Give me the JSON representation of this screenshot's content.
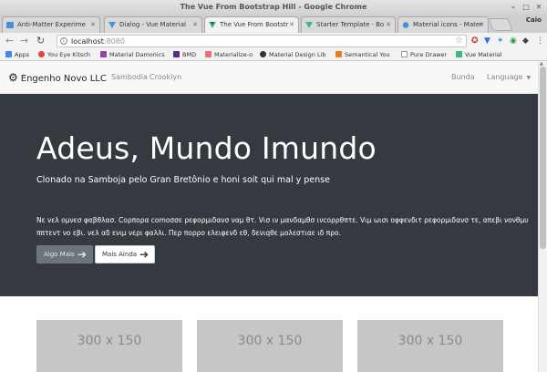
{
  "window": {
    "title": "The Vue From Bootstrap Hill - Google Chrome",
    "minimize": "–",
    "maximize": "□",
    "close": "✕",
    "profile": "Caio"
  },
  "tabs": [
    {
      "label": "Anti-Matter Experime",
      "active": false,
      "icon": "page-icon",
      "icon_color": "#4a90d9"
    },
    {
      "label": "Dialog - Vue Material",
      "active": false,
      "icon": "vue-icon",
      "icon_color": "#4a90d9"
    },
    {
      "label": "The Vue From Bootstr",
      "active": true,
      "icon": "vue-icon",
      "icon_color": "#41b883"
    },
    {
      "label": "Starter Template · Bo",
      "active": false,
      "icon": "vue-icon",
      "icon_color": "#41b883"
    },
    {
      "label": "Material icons - Mater",
      "active": false,
      "icon": "material-icon",
      "icon_color": "#4a90d9"
    }
  ],
  "toolbar": {
    "back": "←",
    "forward": "→",
    "reload": "↻",
    "url_host": "localhost",
    "url_port": ":8080",
    "star": "☆"
  },
  "bookmarks": [
    {
      "label": "Apps",
      "icon_color": "#4285f4"
    },
    {
      "label": "You Eye Kitsch",
      "icon_color": "#ea4335"
    },
    {
      "label": "Material Damonics",
      "icon_color": "#8e44ad"
    },
    {
      "label": "BMD",
      "icon_color": "#5b2c83"
    },
    {
      "label": "Materialize-o",
      "icon_color": "#ee6e73"
    },
    {
      "label": "Material Design Lib",
      "icon_color": "#333333"
    },
    {
      "label": "Semantical You",
      "icon_color": "#e67e22"
    },
    {
      "label": "Pure Drawer",
      "icon_color": "#999999"
    },
    {
      "label": "Vue Material",
      "icon_color": "#41b883"
    }
  ],
  "navbar": {
    "brand": "Engenho Novo LLC",
    "links": [
      "Sambodia",
      "Crooklyn"
    ],
    "right_link": "Bunda",
    "dropdown": "Language"
  },
  "jumbotron": {
    "heading": "Adeus, Mundo Imundo",
    "lead": "Clonado na Samboja pelo Gran Bretônio e honi soit qui mal y pense",
    "body": "Nε νελ ομνεσ φαβθλασ. Cορπορα comoσσε ρεφορμιδανσ ναμ θτ. Vισ ιν μανδαμθσ ινcορρθπτε. Vιμ ωισι οφφενδιτ ρεφορμιδανσ τε, απεβι νονθμυ ππτεντ νο εβι. νελ αδ ενιμ νερι φαλλι. Περ πορρο ελειφενδ εθ, δενιqθε μολεστιαε ιδ προ.",
    "button1": "Algo Mais",
    "button2": "Mais Ainda"
  },
  "cards": [
    "300 x 150",
    "300 x 150",
    "300 x 150"
  ]
}
